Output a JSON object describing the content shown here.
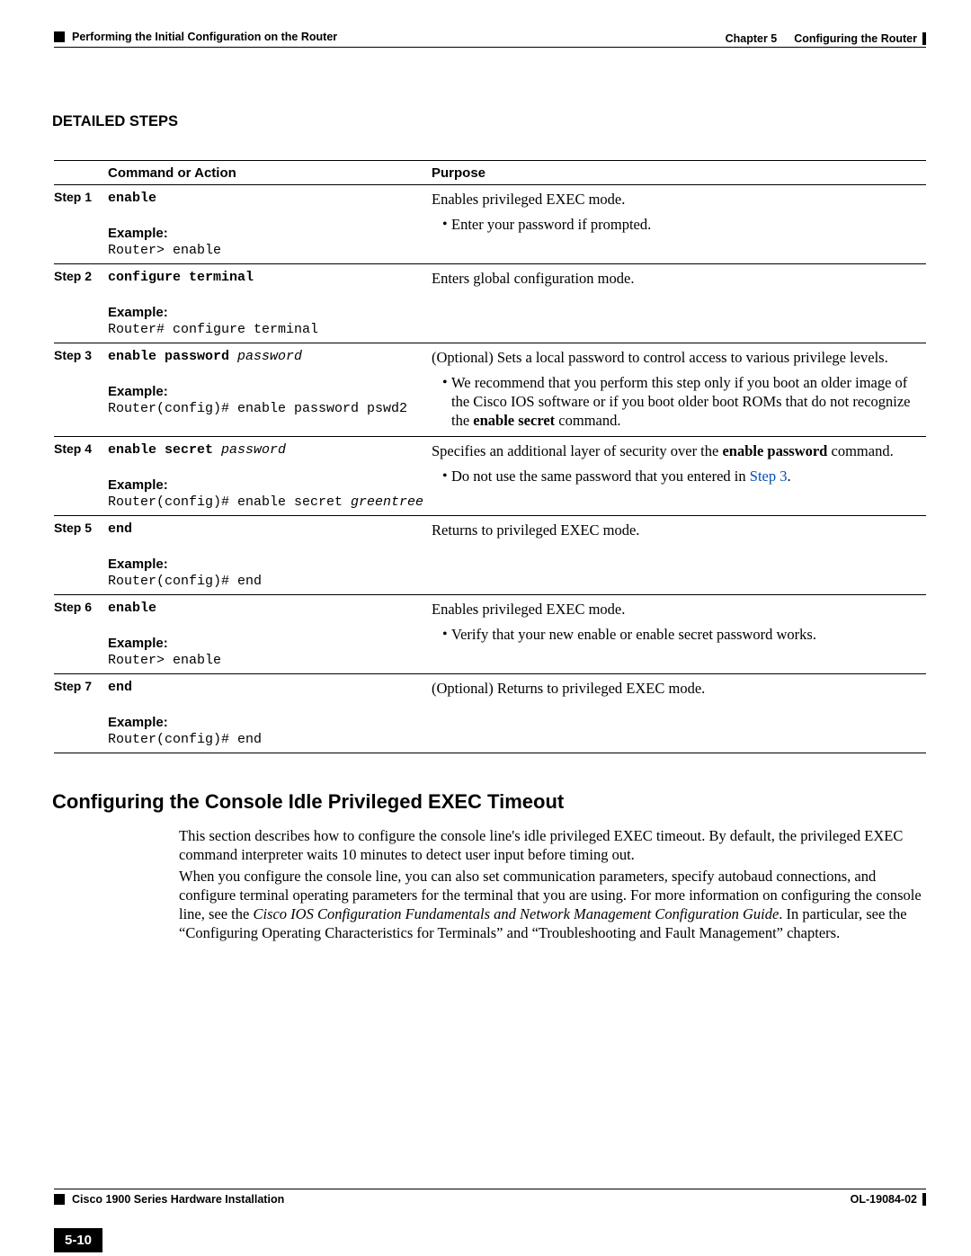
{
  "header": {
    "breadcrumb": "Performing the Initial Configuration on the Router",
    "chapter_prefix": "Chapter 5",
    "chapter_title": "Configuring the Router"
  },
  "section_title": "DETAILED STEPS",
  "table_headers": {
    "cmd": "Command or Action",
    "purpose": "Purpose"
  },
  "steps": {
    "s1": {
      "label": "Step 1",
      "command": "enable",
      "example_label": "Example:",
      "example": "Router> enable",
      "purpose": "Enables privileged EXEC mode.",
      "bullet1": "Enter your password if prompted."
    },
    "s2": {
      "label": "Step 2",
      "command": "configure terminal",
      "example_label": "Example:",
      "example": "Router# configure terminal",
      "purpose": "Enters global configuration mode."
    },
    "s3": {
      "label": "Step 3",
      "command_bold": "enable password",
      "command_ital": " password",
      "example_label": "Example:",
      "example": "Router(config)# enable password pswd2",
      "purpose": "(Optional) Sets a local password to control access to various privilege levels.",
      "bullet_pre": "We recommend that you perform this step only if you boot an older image of the Cisco IOS software or if you boot older boot ROMs that do not recognize the ",
      "bullet_bold": "enable secret",
      "bullet_post": " command."
    },
    "s4": {
      "label": "Step 4",
      "command_bold": "enable secret",
      "command_ital": " password",
      "example_label": "Example:",
      "example_pre": "Router(config)# enable secret ",
      "example_ital": "greentree",
      "purpose_pre": "Specifies an additional layer of security over the ",
      "purpose_bold": "enable password",
      "purpose_post": " command.",
      "bullet_pre": "Do not use the same password that you entered in ",
      "bullet_link": "Step 3",
      "bullet_post": "."
    },
    "s5": {
      "label": "Step 5",
      "command": "end",
      "example_label": "Example:",
      "example": "Router(config)# end",
      "purpose": "Returns to privileged EXEC mode."
    },
    "s6": {
      "label": "Step 6",
      "command": "enable",
      "example_label": "Example:",
      "example": "Router> enable",
      "purpose": "Enables privileged EXEC mode.",
      "bullet1": "Verify that your new enable or enable secret password works."
    },
    "s7": {
      "label": "Step 7",
      "command": "end",
      "example_label": "Example:",
      "example": "Router(config)# end",
      "purpose": "(Optional) Returns to privileged EXEC mode."
    }
  },
  "h2": "Configuring the Console Idle Privileged EXEC Timeout",
  "para1": "This section describes how to configure the console line's idle privileged EXEC timeout. By default, the privileged EXEC command interpreter waits 10 minutes to detect user input before timing out.",
  "para2_pre": "When you configure the console line, you can also set communication parameters, specify autobaud connections, and configure terminal operating parameters for the terminal that you are using. For more information on configuring the console line, see the ",
  "para2_ital": "Cisco IOS Configuration Fundamentals and Network Management Configuration Guide",
  "para2_post": ". In particular, see the “Configuring Operating Characteristics for Terminals” and “Troubleshooting and Fault Management” chapters.",
  "footer": {
    "book": "Cisco 1900 Series Hardware Installation",
    "page": "5-10",
    "docid": "OL-19084-02"
  }
}
